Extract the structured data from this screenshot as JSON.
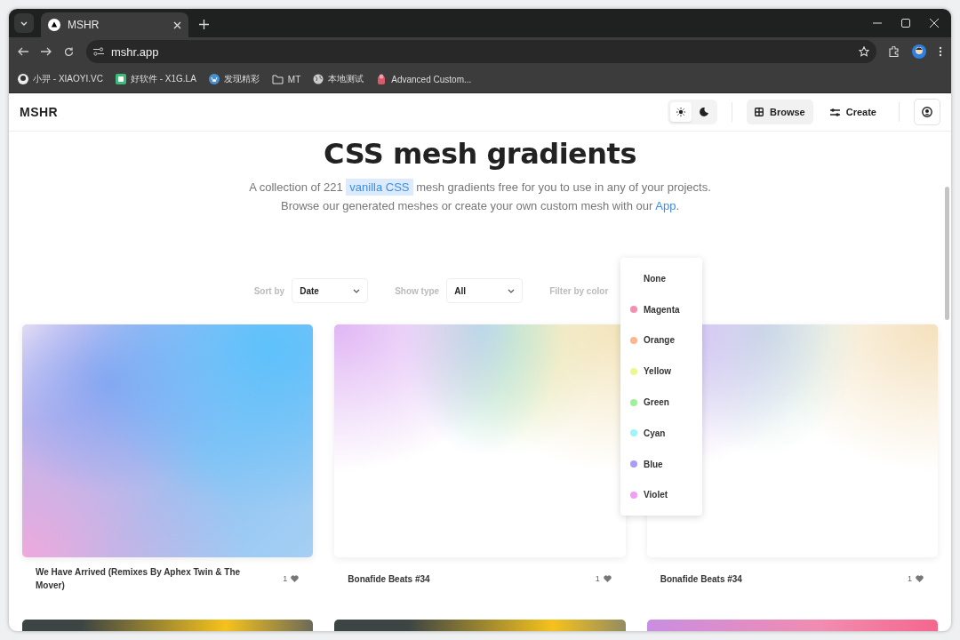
{
  "browser": {
    "tab_title": "MSHR",
    "url": "mshr.app",
    "bookmarks": [
      {
        "label": "小羿 - XIAOYI.VC",
        "kind": "avatar"
      },
      {
        "label": "好软件 - X1G.LA",
        "kind": "app"
      },
      {
        "label": "发现精彩",
        "kind": "wordpress"
      },
      {
        "label": "MT",
        "kind": "folder"
      },
      {
        "label": "本地测试",
        "kind": "globe"
      },
      {
        "label": "Advanced Custom...",
        "kind": "app2"
      }
    ]
  },
  "header": {
    "logo": "MSHR",
    "theme": [
      {
        "kind": "light",
        "selected": true
      },
      {
        "kind": "dark",
        "selected": false
      }
    ],
    "nav": [
      {
        "label": "Browse",
        "kind": "browse",
        "selected": true
      },
      {
        "label": "Create",
        "kind": "create",
        "selected": false
      }
    ]
  },
  "hero": {
    "title": "CSS mesh gradients",
    "description": [
      {
        "text": "A collection of 221 ",
        "kind": "plain"
      },
      {
        "text": "vanilla CSS",
        "kind": "highlight"
      },
      {
        "text": " mesh gradients free for you to use in any of your projects. Browse our generated meshes or create your own custom mesh with our ",
        "kind": "plain"
      },
      {
        "text": "App",
        "kind": "link"
      },
      {
        "text": ".",
        "kind": "plain"
      }
    ]
  },
  "filters": {
    "sort_by": {
      "label": "Sort by",
      "value": "Date"
    },
    "show_type": {
      "label": "Show type",
      "value": "All"
    },
    "filter_by_color": {
      "label": "Filter by color",
      "expanded": true,
      "options": [
        {
          "label": "None"
        },
        {
          "label": "Magenta",
          "color": "#f48fb1"
        },
        {
          "label": "Orange",
          "color": "#ffb58e"
        },
        {
          "label": "Yellow",
          "color": "#eef78c"
        },
        {
          "label": "Green",
          "color": "#a0f09a"
        },
        {
          "label": "Cyan",
          "color": "#9ef4f8"
        },
        {
          "label": "Blue",
          "color": "#a99ef6"
        },
        {
          "label": "Violet",
          "color": "#f29ef2"
        }
      ]
    }
  },
  "cards": [
    {
      "title": "We Have Arrived (Remixes By Aphex Twin & The Mover)",
      "likes": "1"
    },
    {
      "title": "Bonafide Beats #34",
      "likes": "1"
    },
    {
      "title": "Bonafide Beats #34",
      "likes": "1"
    },
    {
      "kind": "cut_off"
    },
    {
      "kind": "cut_off"
    },
    {
      "kind": "cut_off"
    }
  ]
}
